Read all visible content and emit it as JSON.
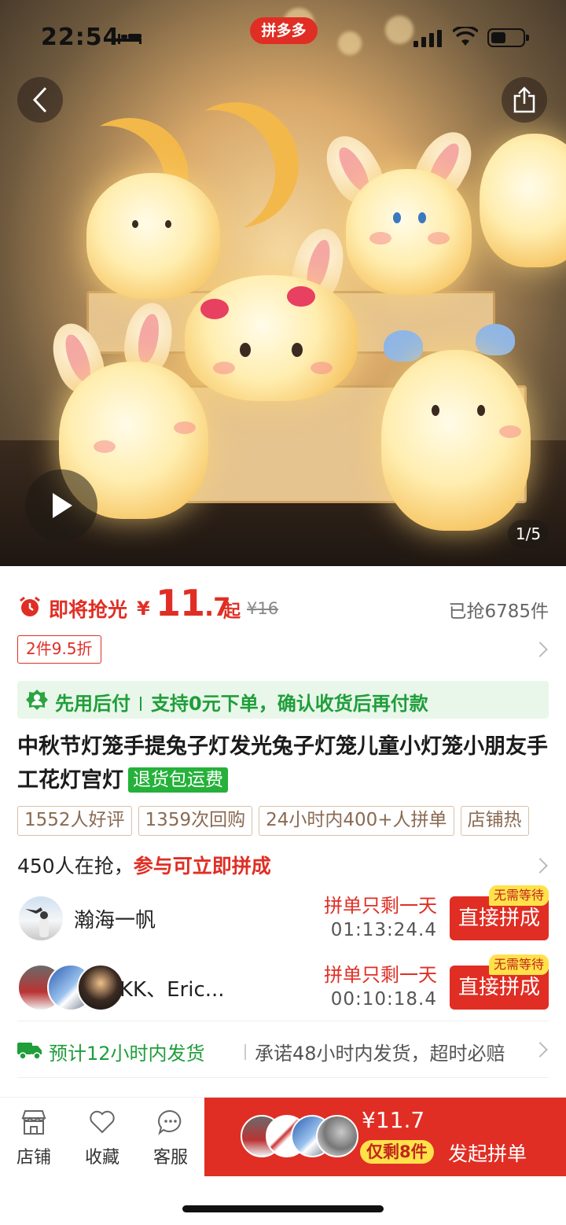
{
  "status_bar": {
    "time": "22:54",
    "app_badge": "拼多多"
  },
  "hero": {
    "image_counter": "1/5"
  },
  "price": {
    "flash_label": "即将抢光",
    "currency": "¥",
    "price_int": "11",
    "price_dec": ".7",
    "from_suffix": "起",
    "original_price": "¥16",
    "sold": "已抢6785件"
  },
  "discount_tag": "2件9.5折",
  "pay_later": {
    "label": "先用后付",
    "desc": "支持0元下单，确认收货后再付款"
  },
  "product": {
    "title": "中秋节灯笼手提兔子灯发光兔子灯笼儿童小灯笼小朋友手工花灯宫灯",
    "return_tag": "退货包运费"
  },
  "tags": [
    "1552人好评",
    "1359次回购",
    "24小时内400+人拼单",
    "店铺热"
  ],
  "grab": {
    "count_text": "450人在抢，",
    "cta": "参与可立即拼成"
  },
  "groups": [
    {
      "name": "瀚海一帆",
      "left_text": "拼单只剩一天",
      "timer": "01:13:24.4",
      "button": "直接拼成",
      "badge": "无需等待"
    },
    {
      "name": "KK、Eric...",
      "left_text": "拼单只剩一天",
      "timer": "00:10:18.4",
      "button": "直接拼成",
      "badge": "无需等待"
    }
  ],
  "shipping": {
    "estimate": "预计12小时内发货",
    "promise": "承诺48小时内发货，超时必赔"
  },
  "bottom_bar": {
    "store": "店铺",
    "favorite": "收藏",
    "service": "客服",
    "buy_price": "¥11.7",
    "stock_left": "仅剩8件",
    "start_group": "发起拼单"
  },
  "colors": {
    "accent": "#e02e24",
    "green": "#1f9e3a",
    "badge_yellow": "#ffe14a"
  }
}
